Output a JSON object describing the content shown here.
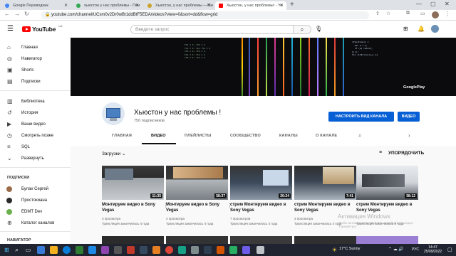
{
  "browser": {
    "tabs": [
      {
        "title": "Google Переводчик"
      },
      {
        "title": "хьюстон у нас проблемы - Пои"
      },
      {
        "title": "Хьюстон, у нас проблемы — Ви"
      },
      {
        "title": "Хьюстон, у нас проблемы! - Yo"
      }
    ],
    "url": "youtube.com/channel/UCsm0v2Dr0wBt1ddBtF5EDA/videos?view=0&sort=dd&flow=grid"
  },
  "youtube": {
    "logo_text": "YouTube",
    "logo_region": "UA",
    "search_placeholder": "Введите запрос"
  },
  "sidebar": {
    "items": [
      {
        "icon": "home-icon",
        "label": "Главная"
      },
      {
        "icon": "compass-icon",
        "label": "Навигатор"
      },
      {
        "icon": "shorts-icon",
        "label": "Shorts"
      },
      {
        "icon": "subscriptions-icon",
        "label": "Подписки"
      },
      {
        "icon": "library-icon",
        "label": "Библиотека"
      },
      {
        "icon": "history-icon",
        "label": "История"
      },
      {
        "icon": "your-videos-icon",
        "label": "Ваши видео"
      },
      {
        "icon": "watch-later-icon",
        "label": "Смотреть позже"
      },
      {
        "icon": "playlist-icon",
        "label": "SQL"
      },
      {
        "icon": "chevron-down-icon",
        "label": "Развернуть"
      }
    ],
    "subs_header": "ПОДПИСКИ",
    "subscriptions": [
      {
        "label": "Булах Сергей"
      },
      {
        "label": "Простокиана"
      },
      {
        "label": "EDMT Dev"
      },
      {
        "label": "Каталог каналов"
      }
    ],
    "nav_header": "НАВИГАТОР"
  },
  "banner": {
    "badge": "GooglePlay"
  },
  "channel": {
    "name": "Хьюстон у нас проблемы !",
    "subscribers": "750 подписчиков",
    "customize_label": "НАСТРОИТЬ ВИД КАНАЛА",
    "videos_button": "ВИДЕО",
    "tabs": [
      "ГЛАВНАЯ",
      "ВИДЕО",
      "ПЛЕЙЛИСТЫ",
      "СООБЩЕСТВО",
      "КАНАЛЫ",
      "О КАНАЛЕ"
    ]
  },
  "filters": {
    "uploads": "Загрузки",
    "sort": "УПОРЯДОЧИТЬ"
  },
  "videos": [
    {
      "title": "Монтируем видео в Sony Vegas",
      "views": "3 просмотра",
      "meta": "Трансляция закончилась 4 года",
      "duration": "11:35"
    },
    {
      "title": "Монтируем видео в Sony Vegas",
      "views": "4 просмотра",
      "meta": "Трансляция закончилась 4 года",
      "duration": "58:37"
    },
    {
      "title": "стрим Монтируем видео в Sony Vegas",
      "views": "7 просмотров",
      "meta": "Трансляция закончилась 4 года",
      "duration": "26:24"
    },
    {
      "title": "стрим Монтируем видео в Sony Vegas",
      "views": "3 просмотра",
      "meta": "Трансляция закончилась 4 года",
      "duration": "7:41"
    },
    {
      "title": "стрим Монтируем видео в Sony Vegas",
      "views": "",
      "meta": "Трансляция закончилась 4 года",
      "duration": "58:12"
    }
  ],
  "windows_activation": {
    "title": "Активация Windows",
    "line1": "Чтобы активировать Windows, перейдите в раздел",
    "line2": "\"Параметры\"."
  },
  "taskbar": {
    "weather": "17°C  Sunny",
    "lang": "РУС",
    "time": "14:47",
    "date": "25/09/2022"
  }
}
